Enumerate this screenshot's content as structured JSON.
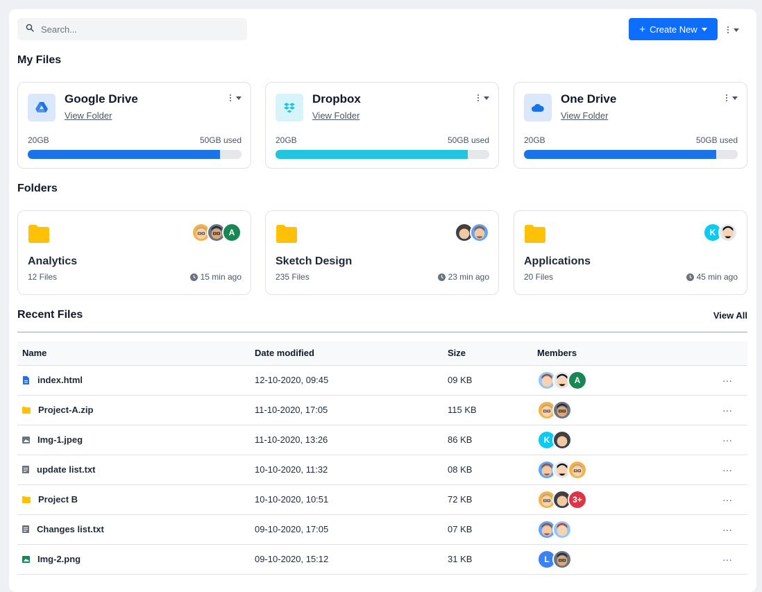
{
  "search": {
    "placeholder": "Search..."
  },
  "toolbar": {
    "create_label": "Create New"
  },
  "my_files": {
    "title": "My Files",
    "cards": [
      {
        "name": "Google Drive",
        "link": "View Folder",
        "left": "20GB",
        "right": "50GB used",
        "progress": 0.9,
        "color": "#1a73e8",
        "icon": "google-drive-icon"
      },
      {
        "name": "Dropbox",
        "link": "View Folder",
        "left": "20GB",
        "right": "50GB used",
        "progress": 0.9,
        "color": "#22c5e0",
        "icon": "dropbox-icon"
      },
      {
        "name": "One Drive",
        "link": "View Folder",
        "left": "20GB",
        "right": "50GB used",
        "progress": 0.9,
        "color": "#1a73e8",
        "icon": "onedrive-icon"
      }
    ]
  },
  "folders": {
    "title": "Folders",
    "items": [
      {
        "name": "Analytics",
        "count": "12 Files",
        "time": "15 min ago"
      },
      {
        "name": "Sketch Design",
        "count": "235 Files",
        "time": "23 min ago"
      },
      {
        "name": "Applications",
        "count": "20 Files",
        "time": "45 min ago"
      }
    ]
  },
  "recent": {
    "title": "Recent Files",
    "view_all": "View All",
    "columns": [
      "Name",
      "Date modified",
      "Size",
      "Members"
    ],
    "rows": [
      {
        "name": "index.html",
        "date": "12-10-2020, 09:45",
        "size": "09 KB",
        "icon": "html-file-icon"
      },
      {
        "name": "Project-A.zip",
        "date": "11-10-2020, 17:05",
        "size": "115 KB",
        "icon": "folder-icon"
      },
      {
        "name": "Img-1.jpeg",
        "date": "11-10-2020, 13:26",
        "size": "86 KB",
        "icon": "image-file-icon"
      },
      {
        "name": "update list.txt",
        "date": "10-10-2020, 11:32",
        "size": "08 KB",
        "icon": "text-file-icon"
      },
      {
        "name": "Project B",
        "date": "10-10-2020, 10:51",
        "size": "72 KB",
        "icon": "folder-icon"
      },
      {
        "name": "Changes list.txt",
        "date": "09-10-2020, 17:05",
        "size": "07 KB",
        "icon": "text-file-icon"
      },
      {
        "name": "Img-2.png",
        "date": "09-10-2020, 15:12",
        "size": "31 KB",
        "icon": "image-file-icon"
      }
    ],
    "badges": {
      "a": "A",
      "k": "K",
      "more": "3+",
      "l": "L"
    }
  },
  "colors": {
    "accent": "#0d6efd",
    "folder": "#ffc107",
    "green": "#198754",
    "cyan": "#0dcaf0",
    "red": "#dc3545",
    "blue": "#3b82f6"
  }
}
